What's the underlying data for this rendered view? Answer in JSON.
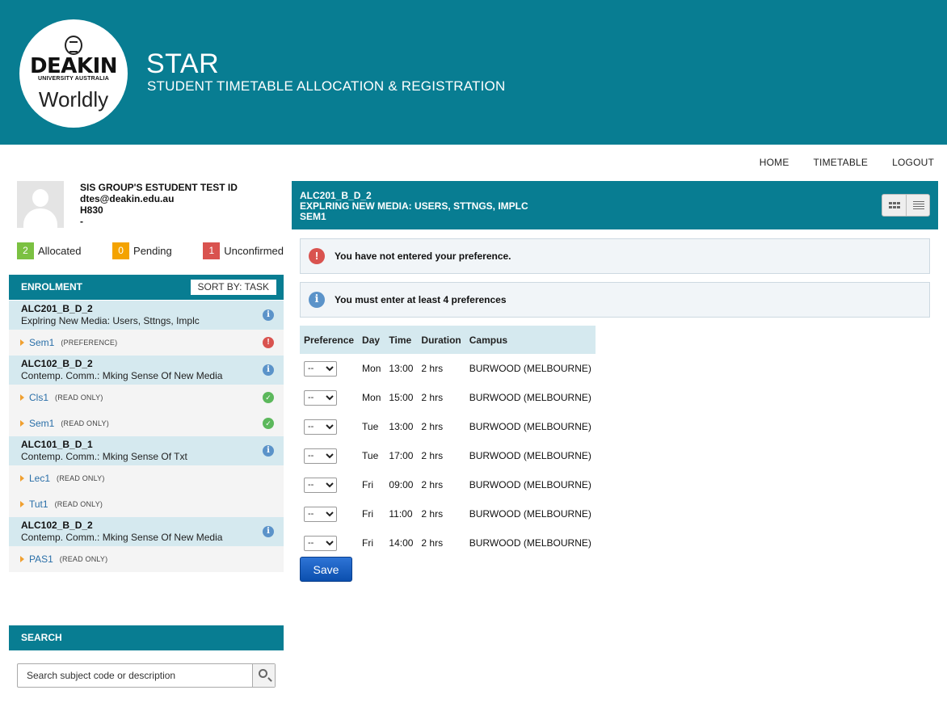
{
  "header": {
    "logo_main": "DEAKIN",
    "logo_sub": "UNIVERSITY AUSTRALIA",
    "logo_tag": "Worldly",
    "title": "STAR",
    "subtitle": "STUDENT TIMETABLE ALLOCATION & REGISTRATION"
  },
  "nav": {
    "home": "HOME",
    "timetable": "TIMETABLE",
    "logout": "LOGOUT"
  },
  "profile": {
    "name": "SIS GROUP'S ESTUDENT TEST ID",
    "email": "dtes@deakin.edu.au",
    "course": "H830",
    "extra": "-"
  },
  "counts": {
    "allocated": {
      "value": "2",
      "label": "Allocated",
      "color": "#7bc142"
    },
    "pending": {
      "value": "0",
      "label": "Pending",
      "color": "#f4a300"
    },
    "unconfirmed": {
      "value": "1",
      "label": "Unconfirmed",
      "color": "#d9534f"
    }
  },
  "enrolment": {
    "heading": "ENROLMENT",
    "sort_label": "SORT BY: TASK",
    "subjects": [
      {
        "code": "ALC201_B_D_2",
        "title": "Explring New Media: Users, Sttngs, Implc",
        "items": [
          {
            "name": "Sem1",
            "tag": "(PREFERENCE)"
          }
        ]
      },
      {
        "code": "ALC102_B_D_2",
        "title": "Contemp. Comm.: Mking Sense Of New Media",
        "items": [
          {
            "name": "Cls1",
            "tag": "(READ ONLY)"
          },
          {
            "name": "Sem1",
            "tag": "(READ ONLY)"
          }
        ]
      },
      {
        "code": "ALC101_B_D_1",
        "title": "Contemp. Comm.: Mking Sense Of Txt",
        "items": [
          {
            "name": "Lec1",
            "tag": "(READ ONLY)"
          },
          {
            "name": "Tut1",
            "tag": "(READ ONLY)"
          }
        ]
      },
      {
        "code": "ALC102_B_D_2",
        "title": "Contemp. Comm.: Mking Sense Of New Media",
        "items": [
          {
            "name": "PAS1",
            "tag": "(READ ONLY)"
          }
        ]
      }
    ]
  },
  "search": {
    "heading": "SEARCH",
    "placeholder": "Search subject code or description"
  },
  "activity": {
    "code": "ALC201_B_D_2",
    "title": "EXPLRING NEW MEDIA: USERS, STTNGS, IMPLC",
    "period": "SEM1"
  },
  "alerts": {
    "error": "You have not entered your preference.",
    "info": "You must enter at least 4 preferences"
  },
  "table": {
    "headers": [
      "Preference",
      "Day",
      "Time",
      "Duration",
      "Campus"
    ],
    "rows": [
      {
        "pref": "--",
        "day": "Mon",
        "time": "13:00",
        "duration": "2 hrs",
        "campus": "BURWOOD (MELBOURNE)"
      },
      {
        "pref": "--",
        "day": "Mon",
        "time": "15:00",
        "duration": "2 hrs",
        "campus": "BURWOOD (MELBOURNE)"
      },
      {
        "pref": "--",
        "day": "Tue",
        "time": "13:00",
        "duration": "2 hrs",
        "campus": "BURWOOD (MELBOURNE)"
      },
      {
        "pref": "--",
        "day": "Tue",
        "time": "17:00",
        "duration": "2 hrs",
        "campus": "BURWOOD (MELBOURNE)"
      },
      {
        "pref": "--",
        "day": "Fri",
        "time": "09:00",
        "duration": "2 hrs",
        "campus": "BURWOOD (MELBOURNE)"
      },
      {
        "pref": "--",
        "day": "Fri",
        "time": "11:00",
        "duration": "2 hrs",
        "campus": "BURWOOD (MELBOURNE)"
      },
      {
        "pref": "--",
        "day": "Fri",
        "time": "14:00",
        "duration": "2 hrs",
        "campus": "BURWOOD (MELBOURNE)"
      }
    ]
  },
  "save_label": "Save"
}
